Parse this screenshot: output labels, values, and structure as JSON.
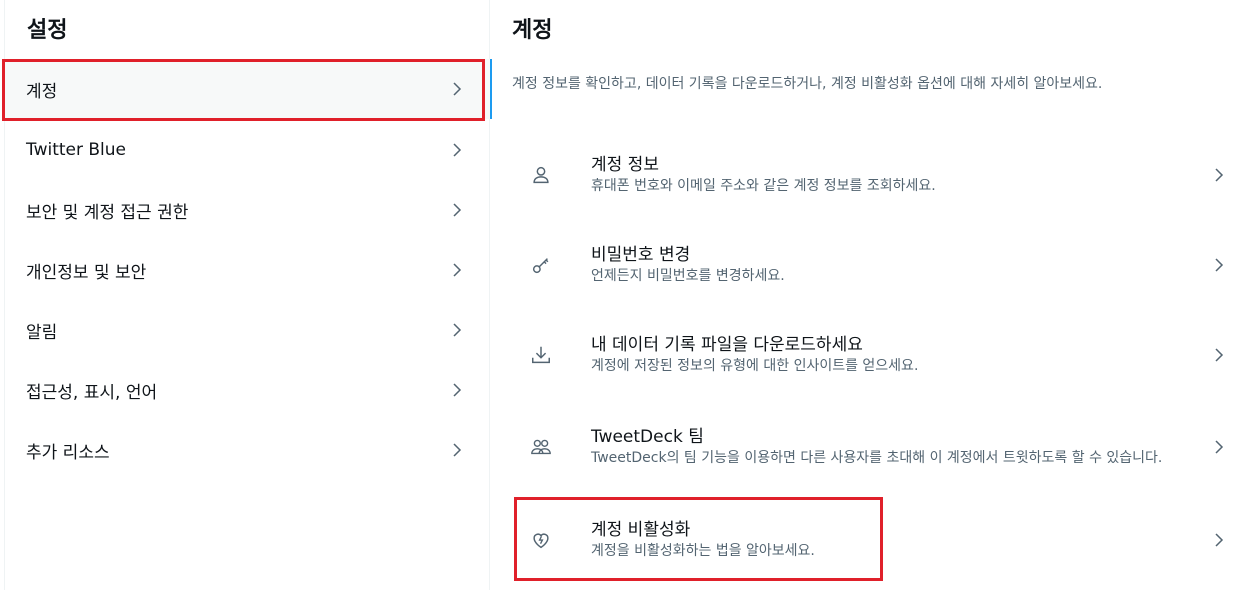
{
  "left": {
    "title": "설정",
    "items": [
      {
        "label": "계정"
      },
      {
        "label": "Twitter Blue"
      },
      {
        "label": "보안 및 계정 접근 권한"
      },
      {
        "label": "개인정보 및 보안"
      },
      {
        "label": "알림"
      },
      {
        "label": "접근성, 표시, 언어"
      },
      {
        "label": "추가 리소스"
      }
    ]
  },
  "right": {
    "title": "계정",
    "description": "계정 정보를 확인하고, 데이터 기록을 다운로드하거나, 계정 비활성화 옵션에 대해 자세히 알아보세요.",
    "items": [
      {
        "title": "계정 정보",
        "subtitle": "휴대폰 번호와 이메일 주소와 같은 계정 정보를 조회하세요.",
        "icon": "person-icon"
      },
      {
        "title": "비밀번호 변경",
        "subtitle": "언제든지 비밀번호를 변경하세요.",
        "icon": "key-icon"
      },
      {
        "title": "내 데이터 기록 파일을 다운로드하세요",
        "subtitle": "계정에 저장된 정보의 유형에 대한 인사이트를 얻으세요.",
        "icon": "download-icon"
      },
      {
        "title": "TweetDeck 팀",
        "subtitle": "TweetDeck의 팀 기능을 이용하면 다른 사용자를 초대해 이 계정에서 트윗하도록 할 수 있습니다.",
        "icon": "people-icon"
      },
      {
        "title": "계정 비활성화",
        "subtitle": "계정을 비활성화하는 법을 알아보세요.",
        "icon": "broken-heart-icon"
      }
    ]
  },
  "colors": {
    "accent": "#1d9bf0",
    "highlight": "#e0202a",
    "secondary_text": "#536471"
  }
}
